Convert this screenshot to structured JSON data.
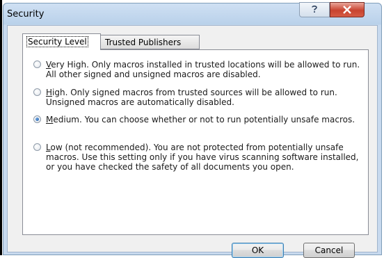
{
  "window": {
    "title": "Security"
  },
  "tabs": [
    {
      "label": "Security Level",
      "active": true
    },
    {
      "label": "Trusted Publishers",
      "active": false
    }
  ],
  "options": [
    {
      "accel": "V",
      "rest": "ery High. Only macros installed in trusted locations will be allowed to run. All other signed and unsigned macros are disabled.",
      "checked": false
    },
    {
      "accel": "H",
      "rest": "igh. Only signed macros from trusted sources will be allowed to run. Unsigned macros are automatically disabled.",
      "checked": false
    },
    {
      "accel": "M",
      "rest": "edium. You can choose whether or not to run potentially unsafe macros.",
      "checked": true
    },
    {
      "accel": "L",
      "rest": "ow (not recommended). You are not protected from potentially unsafe macros. Use this setting only if you have virus scanning software installed, or you have checked the safety of all documents you open.",
      "checked": false
    }
  ],
  "buttons": {
    "ok": "OK",
    "cancel": "Cancel"
  },
  "icons": {
    "help": "help-icon",
    "close": "close-icon"
  },
  "colors": {
    "titlebar": "#b9d1ea",
    "close": "#c8432f",
    "panel": "#ffffff"
  }
}
